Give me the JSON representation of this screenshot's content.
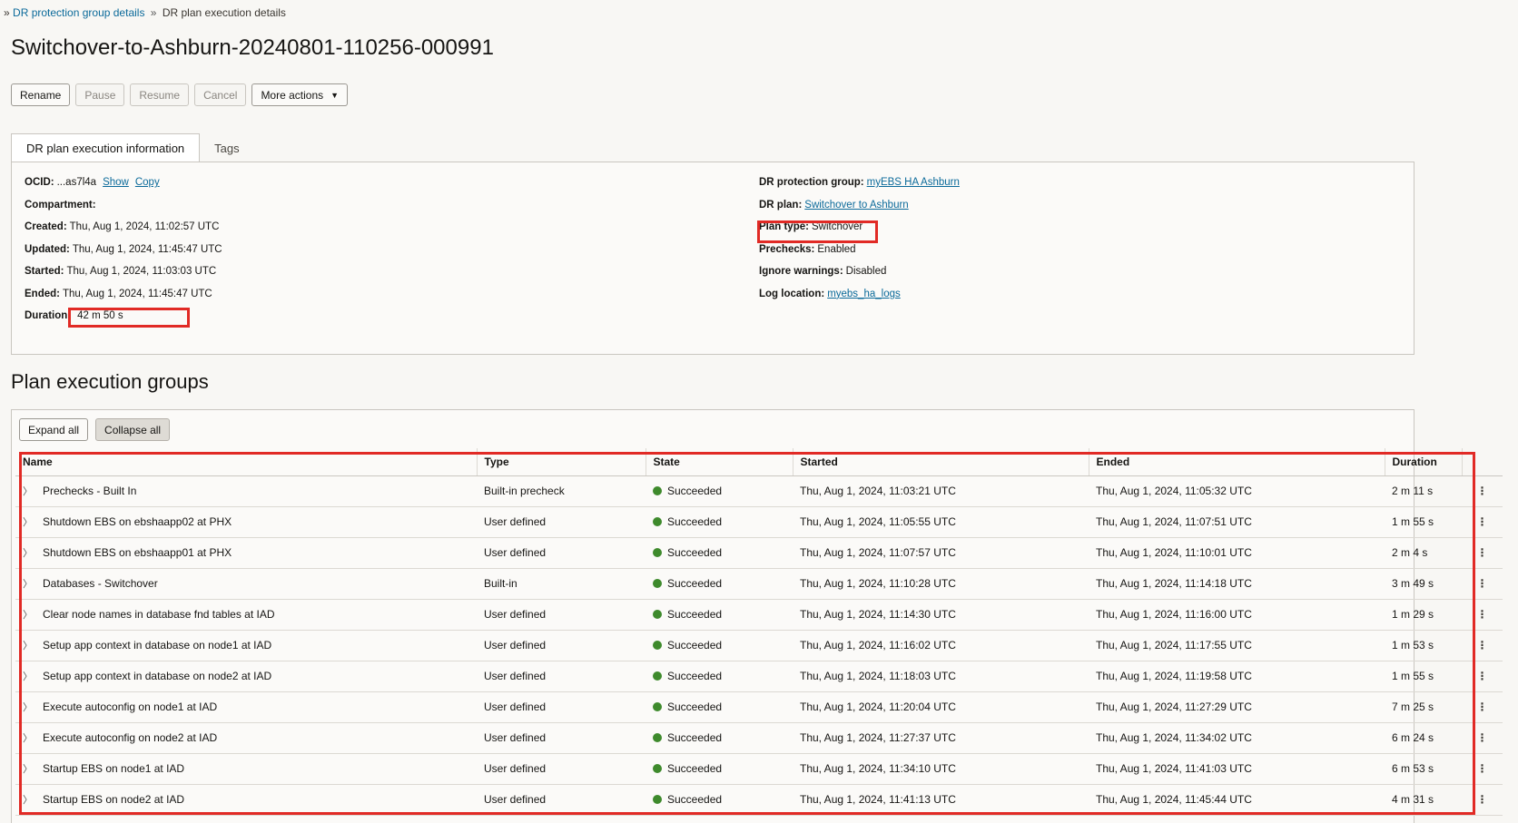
{
  "breadcrumb": {
    "prefix": "»",
    "parent_label": "DR protection group details",
    "sep": "»",
    "current_label": "DR plan execution details"
  },
  "page": {
    "title": "Switchover-to-Ashburn-20240801-110256-000991"
  },
  "actions": {
    "rename": "Rename",
    "pause": "Pause",
    "resume": "Resume",
    "cancel": "Cancel",
    "more": "More actions"
  },
  "tabs": {
    "info": "DR plan execution information",
    "tags": "Tags"
  },
  "info": {
    "ocid_label": "OCID:",
    "ocid_value": "...as7l4a",
    "show": "Show",
    "copy": "Copy",
    "compartment_label": "Compartment:",
    "created_label": "Created:",
    "created_value": "Thu, Aug 1, 2024, 11:02:57 UTC",
    "updated_label": "Updated:",
    "updated_value": "Thu, Aug 1, 2024, 11:45:47 UTC",
    "started_label": "Started:",
    "started_value": "Thu, Aug 1, 2024, 11:03:03 UTC",
    "ended_label": "Ended:",
    "ended_value": "Thu, Aug 1, 2024, 11:45:47 UTC",
    "duration_label": "Duration:",
    "duration_value": "42 m 50 s",
    "protection_group_label": "DR protection group:",
    "protection_group_value": "myEBS HA Ashburn",
    "plan_label": "DR plan:",
    "plan_value": "Switchover to Ashburn",
    "plan_type_label": "Plan type:",
    "plan_type_value": "Switchover",
    "prechecks_label": "Prechecks:",
    "prechecks_value": "Enabled",
    "ignore_warnings_label": "Ignore warnings:",
    "ignore_warnings_value": "Disabled",
    "log_location_label": "Log location:",
    "log_location_value": "myebs_ha_logs"
  },
  "groups": {
    "title": "Plan execution groups",
    "expand_all": "Expand all",
    "collapse_all": "Collapse all",
    "columns": {
      "name": "Name",
      "type": "Type",
      "state": "State",
      "started": "Started",
      "ended": "Ended",
      "duration": "Duration"
    },
    "rows": [
      {
        "name": "Prechecks - Built In",
        "type": "Built-in precheck",
        "state": "Succeeded",
        "started": "Thu, Aug 1, 2024, 11:03:21 UTC",
        "ended": "Thu, Aug 1, 2024, 11:05:32 UTC",
        "duration": "2 m 11 s"
      },
      {
        "name": "Shutdown EBS on ebshaapp02 at PHX",
        "type": "User defined",
        "state": "Succeeded",
        "started": "Thu, Aug 1, 2024, 11:05:55 UTC",
        "ended": "Thu, Aug 1, 2024, 11:07:51 UTC",
        "duration": "1 m 55 s"
      },
      {
        "name": "Shutdown EBS on ebshaapp01 at PHX",
        "type": "User defined",
        "state": "Succeeded",
        "started": "Thu, Aug 1, 2024, 11:07:57 UTC",
        "ended": "Thu, Aug 1, 2024, 11:10:01 UTC",
        "duration": "2 m 4 s"
      },
      {
        "name": "Databases - Switchover",
        "type": "Built-in",
        "state": "Succeeded",
        "started": "Thu, Aug 1, 2024, 11:10:28 UTC",
        "ended": "Thu, Aug 1, 2024, 11:14:18 UTC",
        "duration": "3 m 49 s"
      },
      {
        "name": "Clear node names in database fnd tables at IAD",
        "type": "User defined",
        "state": "Succeeded",
        "started": "Thu, Aug 1, 2024, 11:14:30 UTC",
        "ended": "Thu, Aug 1, 2024, 11:16:00 UTC",
        "duration": "1 m 29 s"
      },
      {
        "name": "Setup app context in database on node1 at IAD",
        "type": "User defined",
        "state": "Succeeded",
        "started": "Thu, Aug 1, 2024, 11:16:02 UTC",
        "ended": "Thu, Aug 1, 2024, 11:17:55 UTC",
        "duration": "1 m 53 s"
      },
      {
        "name": "Setup app context in database on node2 at IAD",
        "type": "User defined",
        "state": "Succeeded",
        "started": "Thu, Aug 1, 2024, 11:18:03 UTC",
        "ended": "Thu, Aug 1, 2024, 11:19:58 UTC",
        "duration": "1 m 55 s"
      },
      {
        "name": "Execute autoconfig on node1 at IAD",
        "type": "User defined",
        "state": "Succeeded",
        "started": "Thu, Aug 1, 2024, 11:20:04 UTC",
        "ended": "Thu, Aug 1, 2024, 11:27:29 UTC",
        "duration": "7 m 25 s"
      },
      {
        "name": "Execute autoconfig on node2 at IAD",
        "type": "User defined",
        "state": "Succeeded",
        "started": "Thu, Aug 1, 2024, 11:27:37 UTC",
        "ended": "Thu, Aug 1, 2024, 11:34:02 UTC",
        "duration": "6 m 24 s"
      },
      {
        "name": "Startup EBS on node1 at IAD",
        "type": "User defined",
        "state": "Succeeded",
        "started": "Thu, Aug 1, 2024, 11:34:10 UTC",
        "ended": "Thu, Aug 1, 2024, 11:41:03 UTC",
        "duration": "6 m 53 s"
      },
      {
        "name": "Startup EBS on node2 at IAD",
        "type": "User defined",
        "state": "Succeeded",
        "started": "Thu, Aug 1, 2024, 11:41:13 UTC",
        "ended": "Thu, Aug 1, 2024, 11:45:44 UTC",
        "duration": "4 m 31 s"
      }
    ]
  },
  "colors": {
    "highlight": "#e12a25",
    "success": "#3e8a2c",
    "link": "#0b6a9a"
  },
  "icons": {
    "expander": "chevron-right-icon",
    "status": "status-dot-icon",
    "row_menu": "kebab-menu-icon",
    "dropdown": "caret-down-icon"
  }
}
